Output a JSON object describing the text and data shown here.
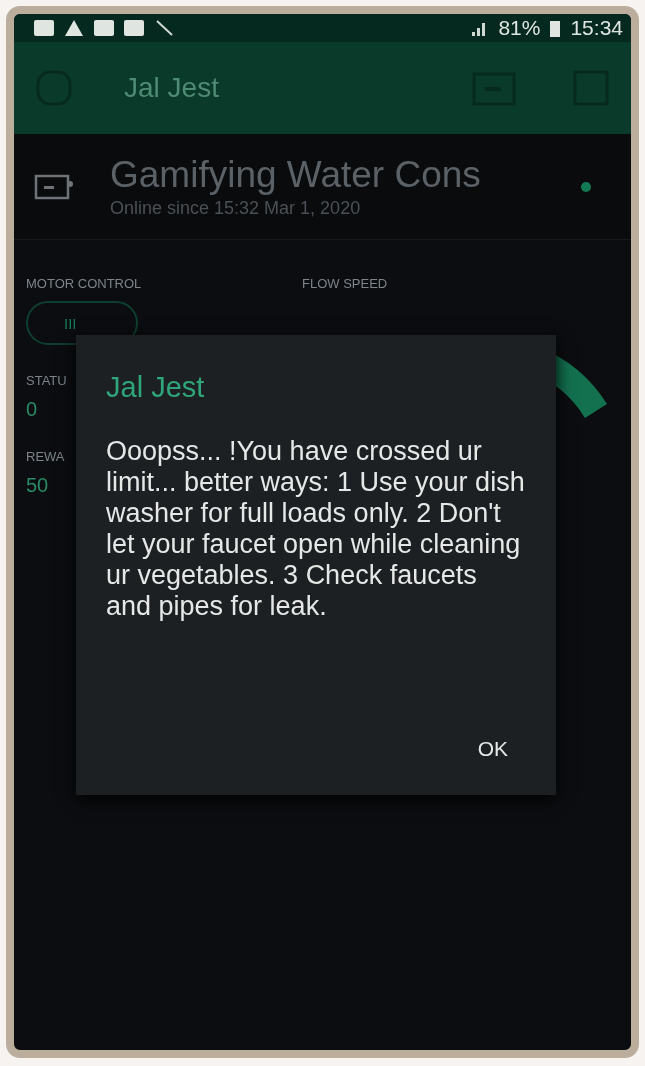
{
  "status_bar": {
    "battery": "81%",
    "time": "15:34"
  },
  "app_bar": {
    "title": "Jal Jest"
  },
  "device": {
    "name": "Gamifying Water Cons",
    "status": "Online since 15:32 Mar 1, 2020",
    "online": true
  },
  "widgets": [
    {
      "kind": "button",
      "label": "MOTOR CONTROL",
      "value": "III"
    },
    {
      "kind": "gauge",
      "label": "FLOW SPEED"
    },
    {
      "kind": "value",
      "label": "STATU",
      "value": "0"
    },
    {
      "kind": "value",
      "label": "REWA",
      "value": "50"
    }
  ],
  "dialog": {
    "title": "Jal Jest",
    "message": "Ooopss... !You have crossed ur limit... better ways: 1 Use your dish washer for full loads only. 2 Don't let your faucet open while cleaning ur vegetables. 3  Check faucets and pipes for leak.",
    "buttons": [
      "OK"
    ]
  }
}
